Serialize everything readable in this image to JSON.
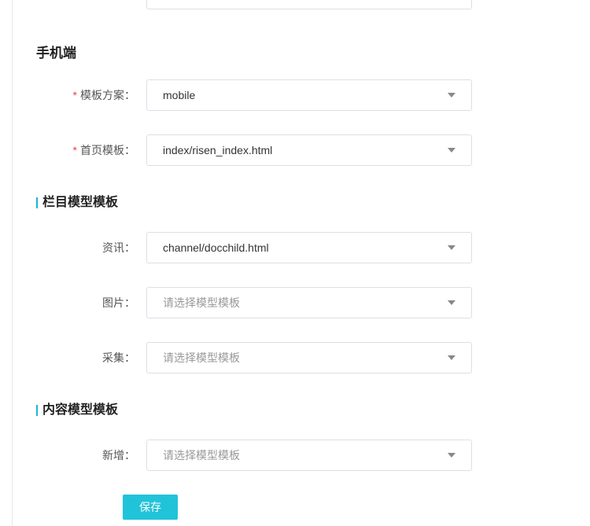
{
  "mobile_section": {
    "title": "手机端",
    "fields": [
      {
        "label": "模板方案：",
        "required": true,
        "value": "mobile",
        "placeholder": ""
      },
      {
        "label": "首页模板：",
        "required": true,
        "value": "index/risen_index.html",
        "placeholder": ""
      }
    ]
  },
  "column_section": {
    "title": "栏目模型模板",
    "fields": [
      {
        "label": "资讯：",
        "required": false,
        "value": "channel/docchild.html",
        "placeholder": ""
      },
      {
        "label": "图片：",
        "required": false,
        "value": "",
        "placeholder": "请选择模型模板"
      },
      {
        "label": "采集：",
        "required": false,
        "value": "",
        "placeholder": "请选择模型模板"
      }
    ]
  },
  "content_section": {
    "title": "内容模型模板",
    "fields": [
      {
        "label": "新增：",
        "required": false,
        "value": "",
        "placeholder": "请选择模型模板"
      }
    ]
  },
  "actions": {
    "save_label": "保存"
  },
  "colors": {
    "accent": "#21c3d9",
    "required": "#e64545"
  },
  "icons": {
    "select_caret": "caret-down-icon"
  }
}
